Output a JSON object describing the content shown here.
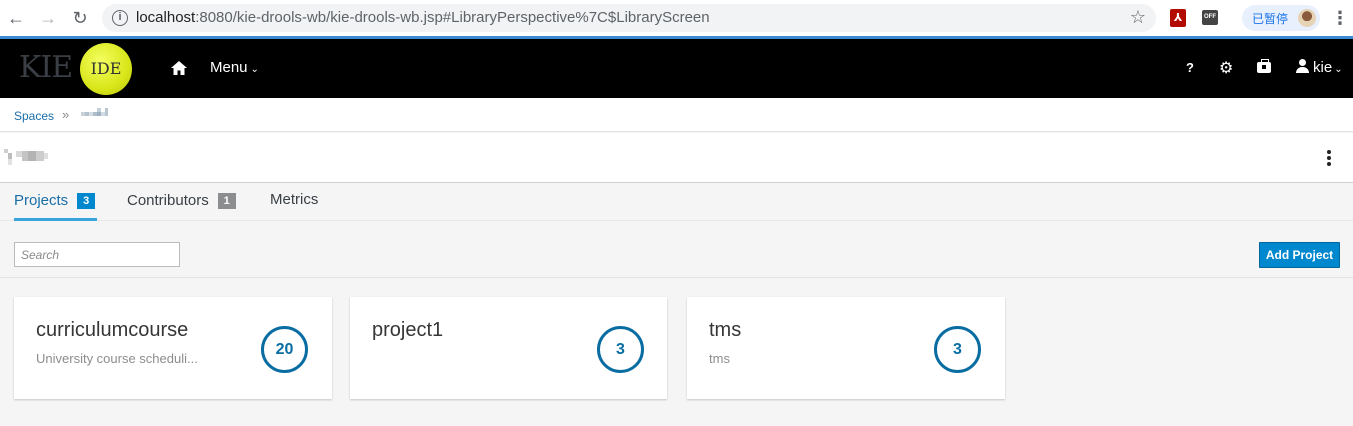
{
  "browser": {
    "url_host": "localhost",
    "url_rest": ":8080/kie-drools-wb/kie-drools-wb.jsp#LibraryPerspective%7C$LibraryScreen",
    "profile_status": "已暂停",
    "ext_pdf_glyph": "⅄",
    "ext_off_label": "OFF"
  },
  "header": {
    "logo_kie": "KIE",
    "logo_ide": "IDE",
    "menu_label": "Menu",
    "help_label": "?",
    "user_label": "kie"
  },
  "breadcrumb": {
    "spaces": "Spaces",
    "separator": "»"
  },
  "tabs": [
    {
      "label": "Projects",
      "badge": "3",
      "active": true
    },
    {
      "label": "Contributors",
      "badge": "1",
      "active": false
    },
    {
      "label": "Metrics",
      "badge": "",
      "active": false
    }
  ],
  "toolbar": {
    "search_placeholder": "Search",
    "add_project_label": "Add Project"
  },
  "projects": [
    {
      "name": "curriculumcourse",
      "description": "University course scheduli...",
      "count": "20"
    },
    {
      "name": "project1",
      "description": "",
      "count": "3"
    },
    {
      "name": "tms",
      "description": "tms",
      "count": "3"
    }
  ],
  "colors": {
    "accent": "#0088ce",
    "header_bg": "#000000",
    "logo_ball": "#d8e619",
    "count_ring": "#0a6da2"
  }
}
